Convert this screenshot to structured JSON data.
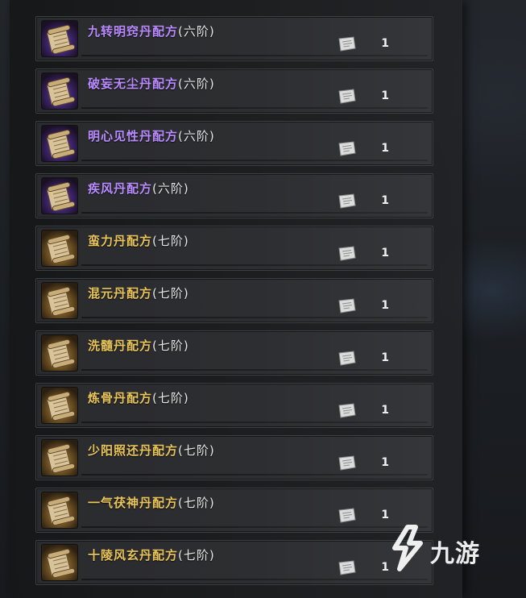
{
  "colors": {
    "purple_text": "#b98bff",
    "gold_text": "#e8c45a",
    "grade_text": "#e6e6e6"
  },
  "items": [
    {
      "name": "九转明窍丹配方",
      "grade": "(六阶)",
      "qty": "1",
      "rarity": "purple",
      "icon": "scroll-icon"
    },
    {
      "name": "破妄无尘丹配方",
      "grade": "(六阶)",
      "qty": "1",
      "rarity": "purple",
      "icon": "scroll-icon"
    },
    {
      "name": "明心见性丹配方",
      "grade": "(六阶)",
      "qty": "1",
      "rarity": "purple",
      "icon": "scroll-icon"
    },
    {
      "name": "疾风丹配方",
      "grade": "(六阶)",
      "qty": "1",
      "rarity": "purple",
      "icon": "scroll-icon"
    },
    {
      "name": "蛮力丹配方",
      "grade": "(七阶)",
      "qty": "1",
      "rarity": "gold",
      "icon": "scroll-icon"
    },
    {
      "name": "混元丹配方",
      "grade": "(七阶)",
      "qty": "1",
      "rarity": "gold",
      "icon": "scroll-icon"
    },
    {
      "name": "洗髓丹配方",
      "grade": "(七阶)",
      "qty": "1",
      "rarity": "gold",
      "icon": "scroll-icon"
    },
    {
      "name": "炼骨丹配方",
      "grade": "(七阶)",
      "qty": "1",
      "rarity": "gold",
      "icon": "scroll-icon"
    },
    {
      "name": "少阳照还丹配方",
      "grade": "(七阶)",
      "qty": "1",
      "rarity": "gold",
      "icon": "scroll-icon"
    },
    {
      "name": "一气茯神丹配方",
      "grade": "(七阶)",
      "qty": "1",
      "rarity": "gold",
      "icon": "scroll-icon"
    },
    {
      "name": "十陵风玄丹配方",
      "grade": "(七阶)",
      "qty": "1",
      "rarity": "gold",
      "icon": "scroll-icon"
    }
  ],
  "watermark": {
    "text": "九游",
    "icon": "jiuyou-logo-icon"
  }
}
